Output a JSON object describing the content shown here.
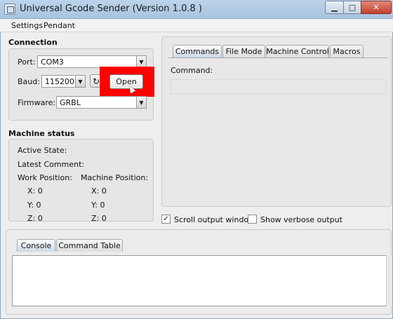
{
  "window": {
    "title": "Universal Gcode Sender (Version 1.0.8 )",
    "controls": {
      "minimize": "▁",
      "maximize": "□",
      "close": "✕"
    }
  },
  "menu": [
    "Settings",
    "Pendant"
  ],
  "connection": {
    "title": "Connection",
    "port_label": "Port:",
    "port_value": "COM3",
    "baud_label": "Baud:",
    "baud_value": "115200",
    "refresh_icon": "↻",
    "open_label": "Open",
    "firmware_label": "Firmware:",
    "firmware_value": "GRBL"
  },
  "machine_status": {
    "title": "Machine status",
    "active_state": "Active State:",
    "latest_comment": "Latest Comment:",
    "work_position": "Work Position:",
    "machine_position": "Machine Position:",
    "work": {
      "x": "X:  0",
      "y": "Y:  0",
      "z": "Z:  0"
    },
    "machine": {
      "x": "X:  0",
      "y": "Y:  0",
      "z": "Z:  0"
    }
  },
  "command_tabs": [
    "Commands",
    "File Mode",
    "Machine Control",
    "Macros"
  ],
  "command_label": "Command:",
  "options": {
    "scroll_output": "Scroll output window",
    "scroll_checked": "✓",
    "verbose_output": "Show verbose output"
  },
  "bottom_tabs": [
    "Console",
    "Command Table"
  ],
  "colors": {
    "highlight": "#ff0000",
    "titlebar": "#bcd3ea"
  }
}
